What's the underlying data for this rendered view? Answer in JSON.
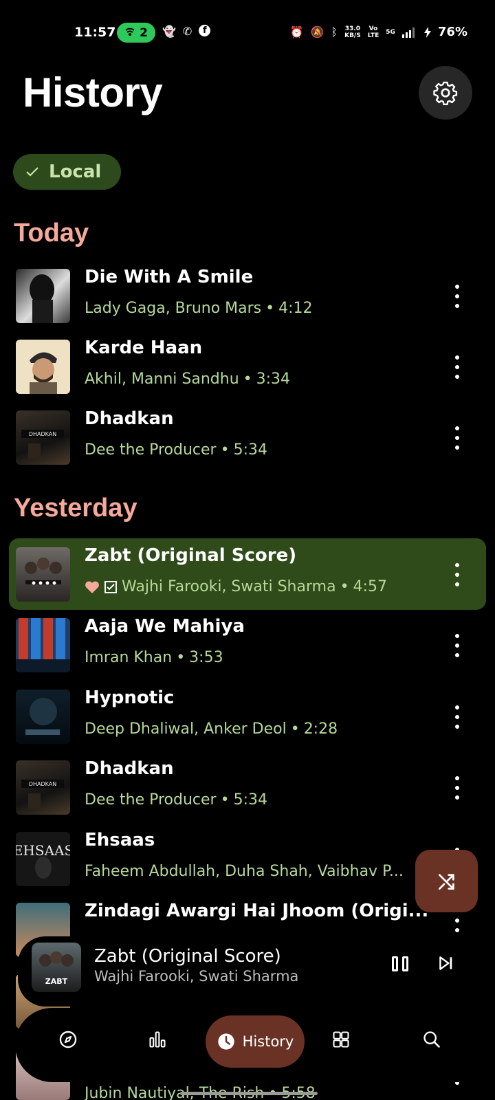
{
  "status_bar": {
    "time": "11:57",
    "hotspot_count": "2",
    "speed_value": "33.0",
    "speed_unit": "KB/S",
    "volte_top": "Vo",
    "volte_bottom": "LTE",
    "network": "5G",
    "battery": "76%"
  },
  "header": {
    "title": "History"
  },
  "filter_chip": {
    "label": "Local",
    "selected": true
  },
  "sections": {
    "today": "Today",
    "yesterday": "Yesterday"
  },
  "today_songs": [
    {
      "title": "Die With A Smile",
      "artist": "Lady Gaga, Bruno Mars",
      "duration": "4:12"
    },
    {
      "title": "Karde Haan",
      "artist": "Akhil, Manni Sandhu",
      "duration": "3:34"
    },
    {
      "title": "Dhadkan",
      "artist": "Dee the Producer",
      "duration": "5:34"
    }
  ],
  "yesterday_songs": [
    {
      "title": "Zabt (Original Score)",
      "artist": "Wajhi Farooki, Swati Sharma",
      "duration": "4:57",
      "liked": true,
      "active": true
    },
    {
      "title": "Aaja We Mahiya",
      "artist": "Imran Khan",
      "duration": "3:53"
    },
    {
      "title": "Hypnotic",
      "artist": "Deep Dhaliwal, Anker Deol",
      "duration": "2:28"
    },
    {
      "title": "Dhadkan",
      "artist": "Dee the Producer",
      "duration": "5:34"
    },
    {
      "title": "Ehsaas",
      "artist": "Faheem Abdullah, Duha Shah, Vaibhav P...",
      "duration": ""
    },
    {
      "title": "Zindagi Awargi Hai Jhoom (Origi...",
      "artist": "",
      "duration": ""
    },
    {
      "title": "",
      "artist": "Jubin Nautiyal, The Rish",
      "duration": "5:58"
    }
  ],
  "separator": "•",
  "mini_player": {
    "title": "Zabt (Original Score)",
    "artist": "Wajhi Farooki, Swati Sharma",
    "state": "playing"
  },
  "bottom_nav": {
    "items": [
      "explore-icon",
      "charts-icon",
      "history-icon",
      "library-icon",
      "search-icon"
    ],
    "active_label": "History"
  },
  "colors": {
    "accent_section": "#f4a99a",
    "subtitle_green": "#b6d99a",
    "active_row": "#2f4b19",
    "fab": "#6a3224"
  }
}
